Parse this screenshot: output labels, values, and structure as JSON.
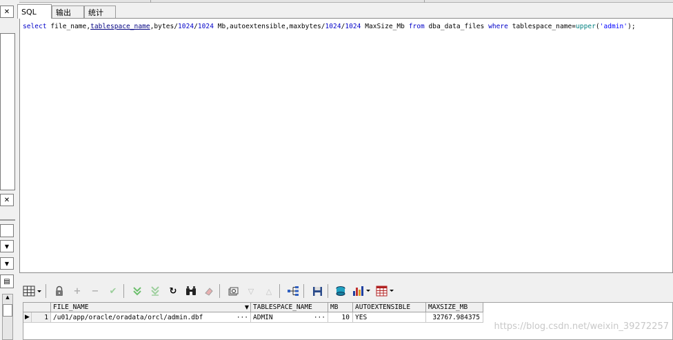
{
  "tabs": [
    {
      "label": "SQL",
      "active": true
    },
    {
      "label": "输出",
      "active": false
    },
    {
      "label": "统计",
      "active": false
    }
  ],
  "sql": {
    "tokens": [
      {
        "t": "select",
        "c": "kw"
      },
      {
        "t": " file_name,",
        "c": ""
      },
      {
        "t": "tablespace_name",
        "c": "ul"
      },
      {
        "t": ",bytes/",
        "c": ""
      },
      {
        "t": "1024",
        "c": "num"
      },
      {
        "t": "/",
        "c": ""
      },
      {
        "t": "1024",
        "c": "num"
      },
      {
        "t": " Mb,autoextensible,maxbytes/",
        "c": ""
      },
      {
        "t": "1024",
        "c": "num"
      },
      {
        "t": "/",
        "c": ""
      },
      {
        "t": "1024",
        "c": "num"
      },
      {
        "t": " MaxSize_Mb ",
        "c": ""
      },
      {
        "t": "from",
        "c": "kw"
      },
      {
        "t": " dba_data_files ",
        "c": ""
      },
      {
        "t": "where",
        "c": "kw"
      },
      {
        "t": " tablespace_name=",
        "c": ""
      },
      {
        "t": "upper",
        "c": "fn"
      },
      {
        "t": "(",
        "c": ""
      },
      {
        "t": "'admin'",
        "c": "str"
      },
      {
        "t": ");",
        "c": ""
      }
    ]
  },
  "grid": {
    "columns": [
      "FILE_NAME",
      "TABLESPACE_NAME",
      "MB",
      "AUTOEXTENSIBLE",
      "MAXSIZE_MB"
    ],
    "rows": [
      {
        "num": "1",
        "file_name": "/u01/app/oracle/oradata/orcl/admin.dbf",
        "tablespace_name": "ADMIN",
        "mb": "10",
        "autoextensible": "YES",
        "maxsize_mb": "32767.984375"
      }
    ]
  },
  "icons": {
    "close": "close-icon",
    "grid_menu": "grid-menu-icon",
    "lock": "lock-icon",
    "add": "add-record-icon",
    "remove": "delete-record-icon",
    "post": "post-changes-icon",
    "fetch_next": "fetch-next-icon",
    "fetch_last": "fetch-last-icon",
    "refresh": "refresh-icon",
    "find": "binoculars-icon",
    "clear": "eraser-icon",
    "query_by_example": "query-by-example-icon",
    "next_record": "next-record-icon",
    "prev_record": "prev-record-icon",
    "tree": "tree-icon",
    "save": "save-icon",
    "export": "export-icon",
    "chart": "chart-icon",
    "table": "table-icon"
  },
  "watermark": "https://blog.csdn.net/weixin_39272257"
}
